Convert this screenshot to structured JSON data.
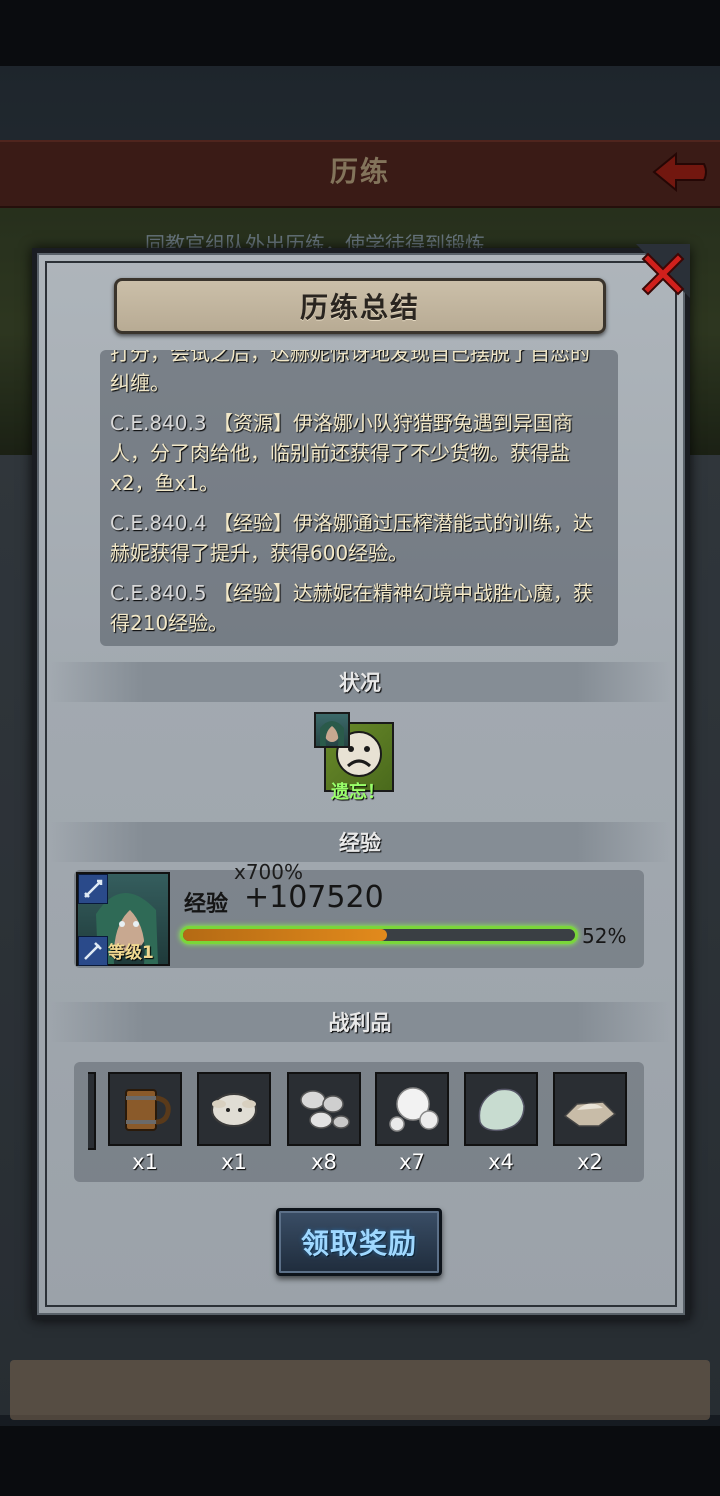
{
  "background": {
    "screen_title": "历练",
    "subtext": "同教官组队外出历练，使学徒得到锻炼"
  },
  "modal": {
    "title": "历练总结",
    "log": [
      {
        "date": "",
        "text": "打分，会试之后，达赫妮惊讶地发现自己摆脱了自恋的纠缠。"
      },
      {
        "date": "C.E.840.3",
        "text": "【资源】伊洛娜小队狩猎野兔遇到异国商人，分了肉给他，临别前还获得了不少货物。获得盐x2，鱼x1。"
      },
      {
        "date": "C.E.840.4",
        "text": "【经验】伊洛娜通过压榨潜能式的训练，达赫妮获得了提升，获得600经验。"
      },
      {
        "date": "C.E.840.5",
        "text": "【经验】达赫妮在精神幻境中战胜心魔，获得210经验。"
      }
    ],
    "status_section": "状况",
    "status_caption": "遗忘！",
    "exp_section": "经验",
    "exp": {
      "multiplier": "x700%",
      "label": "经验",
      "value": "+107520",
      "level": "等级1",
      "progress": 0.52,
      "progress_text": "52%"
    },
    "loot_section": "战利品",
    "loot": [
      {
        "icon": "tankard-icon",
        "count": "x1"
      },
      {
        "icon": "sheep-icon",
        "count": "x1"
      },
      {
        "icon": "silver-ore-icon",
        "count": "x8"
      },
      {
        "icon": "pearl-icon",
        "count": "x7"
      },
      {
        "icon": "stone-icon",
        "count": "x4"
      },
      {
        "icon": "salt-icon",
        "count": "x2"
      }
    ],
    "claim_button": "领取奖励"
  },
  "colors": {
    "accent_green": "#7ad63a",
    "exp_fill": "#e28a1c",
    "status_green": "#9aff6a",
    "button_text": "#9fd8ff"
  }
}
